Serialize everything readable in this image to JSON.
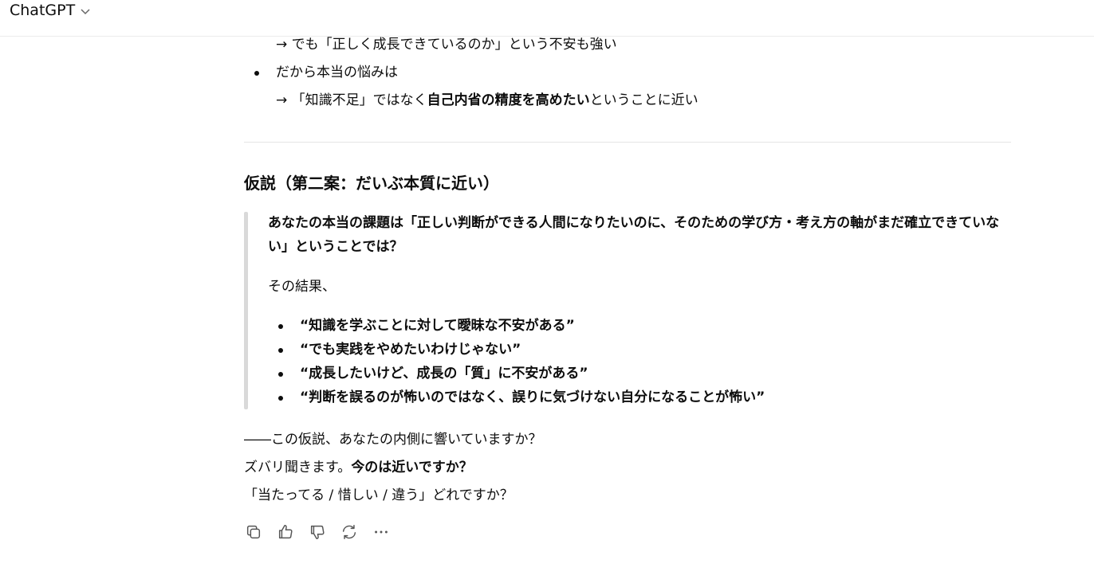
{
  "header": {
    "model_name": "ChatGPT",
    "chevron_icon": "chevron-down-icon"
  },
  "message": {
    "top_lines": [
      "→ でも「正しく成長できているのか」という不安も強い",
      "だから本当の悩みは",
      "→ 「知識不足」ではなく",
      "自己内省の精度を高めたい",
      "ということに近い"
    ],
    "heading": "仮説（第二案：だいぶ本質に近い）",
    "quote": {
      "line1": "あなたの本当の課題は「正しい判断ができる人間になりたいのに、そのための学び方・考え方の軸がまだ確立できていな",
      "line2": "い」ということでは？",
      "result": "その結果、",
      "bullets": [
        "“知識を学ぶことに対して曖昧な不安がある”",
        "“でも実践をやめたいわけじゃない”",
        "“成長したいけど、成長の「質」に不安がある”",
        "“判断を誤るのが怖いのではなく、誤りに気づけない自分になることが怖い”"
      ]
    },
    "closing": {
      "line1": "――この仮説、あなたの内側に響いていますか？",
      "line2_plain": "ズバリ聞きます。",
      "line2_bold": "今のは近いですか？",
      "line3": "「当たってる / 惜しい / 違う」どれですか？"
    }
  },
  "actions": [
    {
      "name": "copy-icon"
    },
    {
      "name": "thumbs-up-icon"
    },
    {
      "name": "thumbs-down-icon"
    },
    {
      "name": "regenerate-icon"
    },
    {
      "name": "more-icon"
    }
  ]
}
